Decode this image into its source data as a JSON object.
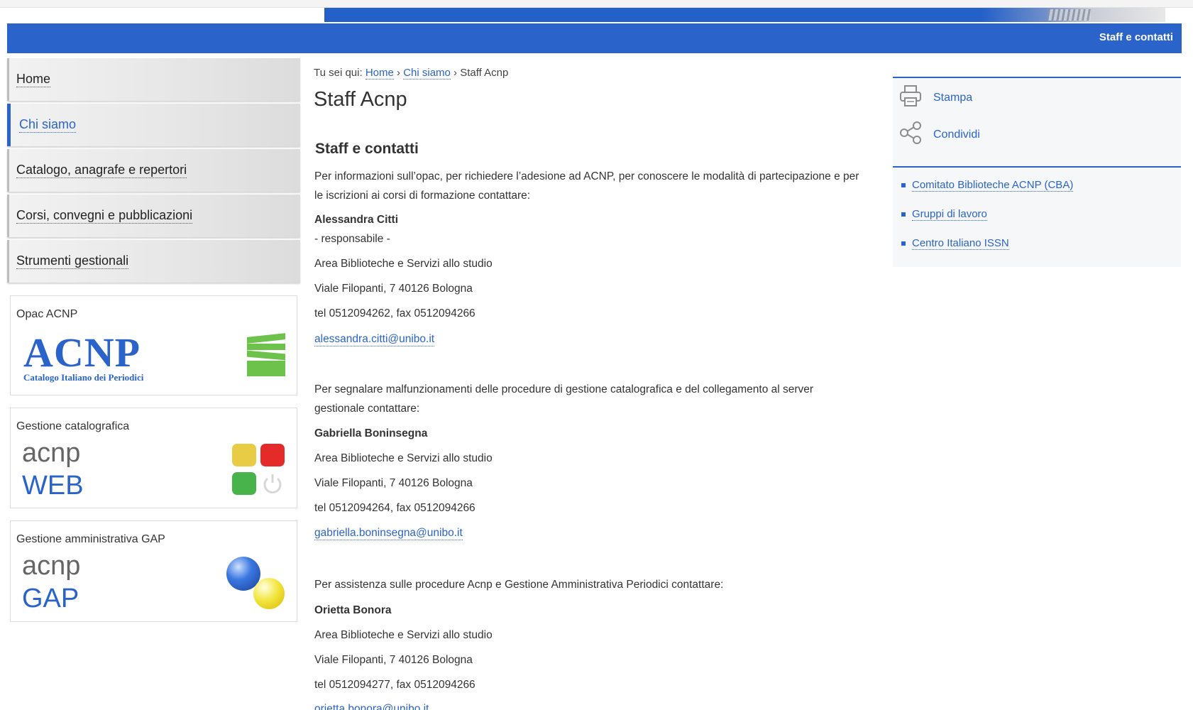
{
  "header": {
    "section_title": "Staff e contatti"
  },
  "nav": {
    "items": [
      {
        "label": "Home"
      },
      {
        "label": "Chi siamo"
      },
      {
        "label": "Catalogo, anagrafe e repertori"
      },
      {
        "label": "Corsi, convegni e pubblicazioni"
      },
      {
        "label": "Strumenti gestionali"
      }
    ]
  },
  "boxes": {
    "opac": {
      "label": "Opac ACNP",
      "logo_text": "ACNP",
      "logo_sub": "Catalogo Italiano dei Periodici"
    },
    "catalog": {
      "label": "Gestione catalografica",
      "word1": "acnp",
      "word2": "WEB"
    },
    "gap": {
      "label": "Gestione amministrativa GAP",
      "word1": "acnp",
      "word2": "GAP"
    }
  },
  "breadcrumb": {
    "prefix": "Tu sei qui:",
    "home": "Home",
    "sep": "›",
    "chi": "Chi siamo",
    "current": "Staff Acnp"
  },
  "main": {
    "title": "Staff Acnp",
    "section": "Staff e contatti",
    "block1": {
      "intro": "Per informazioni sull’opac, per richiedere l’adesione ad ACNP, per conoscere le modalità di partecipazione e per le iscrizioni ai corsi di formazione contattare:",
      "name": "Alessandra Citti",
      "role": "- responsabile -",
      "area": "Area Biblioteche e Servizi allo studio",
      "address": "Viale Filopanti, 7 40126 Bologna",
      "phone": "tel 0512094262, fax 0512094266",
      "email": "alessandra.citti@unibo.it"
    },
    "block2": {
      "intro": "Per segnalare malfunzionamenti delle procedure di gestione catalografica e del collegamento al server gestionale contattare:",
      "name": "Gabriella Boninsegna",
      "area": "Area Biblioteche e Servizi allo studio",
      "address": "Viale Filopanti, 7 40126 Bologna",
      "phone": "tel 0512094264, fax 0512094266",
      "email": "gabriella.boninsegna@unibo.it"
    },
    "block3": {
      "intro": "Per assistenza sulle procedure Acnp e Gestione Amministrativa Periodici contattare:",
      "name": "Orietta Bonora",
      "area": "Area Biblioteche e Servizi allo studio",
      "address": "Viale Filopanti, 7 40126 Bologna",
      "phone": "tel 0512094277, fax 0512094266",
      "email": "orietta.bonora@unibo.it"
    }
  },
  "right": {
    "tools": [
      {
        "label": "Stampa",
        "icon": "printer-icon"
      },
      {
        "label": "Condividi",
        "icon": "share-icon"
      }
    ],
    "links": [
      {
        "label": "Comitato Biblioteche ACNP (CBA)"
      },
      {
        "label": "Gruppi di lavoro"
      },
      {
        "label": "Centro Italiano ISSN"
      }
    ]
  },
  "colors": {
    "brand_blue": "#2a63c9",
    "green": "#6dc24b",
    "yellow": "#e8cc45",
    "red": "#e52a2a"
  }
}
